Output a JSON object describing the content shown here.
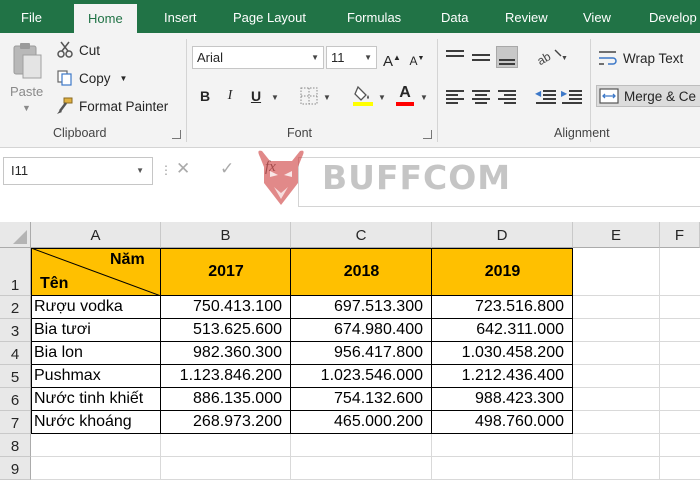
{
  "ribbon_tabs": [
    "File",
    "Home",
    "Insert",
    "Page Layout",
    "Formulas",
    "Data",
    "Review",
    "View",
    "Develop"
  ],
  "active_tab": "Home",
  "clipboard": {
    "paste": "Paste",
    "cut": "Cut",
    "copy": "Copy",
    "format_painter": "Format Painter",
    "group_label": "Clipboard"
  },
  "font": {
    "font_name": "Arial",
    "font_size": "11",
    "bold": "B",
    "italic": "I",
    "underline": "U",
    "group_label": "Font",
    "fill_color": "#ffff00",
    "font_color": "#ff0000"
  },
  "alignment": {
    "wrap_text": "Wrap Text",
    "merge_center": "Merge & Ce",
    "group_label": "Alignment"
  },
  "formula_bar": {
    "name_box": "I11",
    "cancel_icon": "✕",
    "enter_icon": "✓",
    "fx": "fx",
    "content": ""
  },
  "watermark": {
    "text": "BUFFCOM"
  },
  "sheet": {
    "columns": [
      "A",
      "B",
      "C",
      "D",
      "E",
      "F"
    ],
    "rows": [
      "1",
      "2",
      "3",
      "4",
      "5",
      "6",
      "7",
      "8",
      "9"
    ],
    "header_cell": {
      "top": "Năm",
      "bottom": "Tên"
    },
    "years": [
      "2017",
      "2018",
      "2019"
    ],
    "header_fill": "#ffc000",
    "data": [
      {
        "name": "Rượu vodka",
        "values": [
          "750.413.100",
          "697.513.300",
          "723.516.800"
        ]
      },
      {
        "name": "Bia tươi",
        "values": [
          "513.625.600",
          "674.980.400",
          "642.311.000"
        ]
      },
      {
        "name": "Bia lon",
        "values": [
          "982.360.300",
          "956.417.800",
          "1.030.458.200"
        ]
      },
      {
        "name": "Pushmax",
        "values": [
          "1.123.846.200",
          "1.023.546.000",
          "1.212.436.400"
        ]
      },
      {
        "name": "Nước tinh khiết",
        "values": [
          "886.135.000",
          "754.132.600",
          "988.423.300"
        ]
      },
      {
        "name": "Nước khoáng",
        "values": [
          "268.973.200",
          "465.000.200",
          "498.760.000"
        ]
      }
    ]
  }
}
